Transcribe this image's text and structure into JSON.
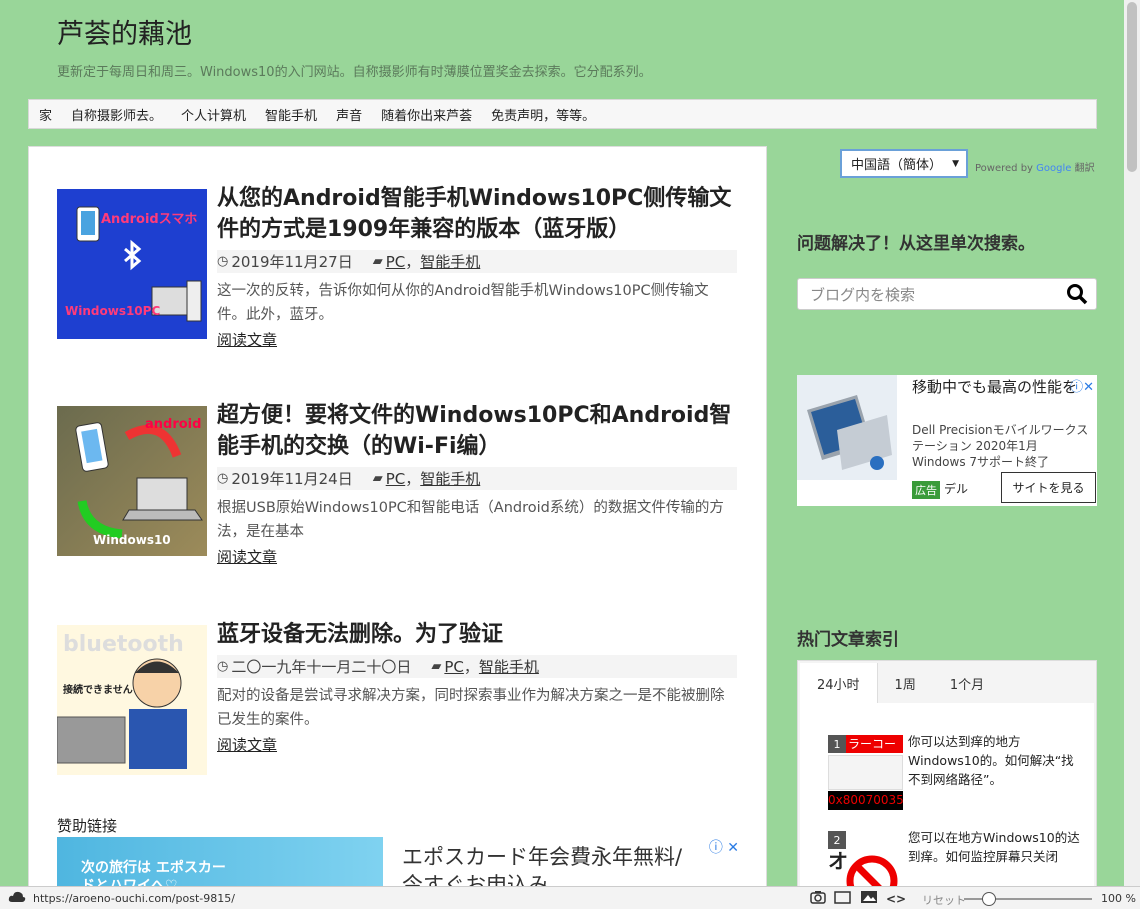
{
  "site": {
    "title": "芦荟的藕池",
    "description": "更新定于每周日和周三。Windows10的入门网站。自称摄影师有时薄膜位置奖金去探索。它分配系列。"
  },
  "nav": {
    "items": [
      "家",
      "自称摄影师去。",
      "个人计算机",
      "智能手机",
      "声音",
      "随着你出来芦荟",
      "免责声明，等等。"
    ]
  },
  "posts": [
    {
      "title": "从您的Android智能手机Windows10PC侧传输文件的方式是1909年兼容的版本（蓝牙版）",
      "date": "2019年11月27日",
      "cat1": "PC",
      "cat2": "智能手机",
      "excerpt": "这一次的反转，告诉你如何从你的Android智能手机Windows10PC侧传输文件。此外，蓝牙。",
      "more": "阅读文章",
      "thumb_text_top": "Androidスマホ",
      "thumb_text_bottom": "Windows10PC"
    },
    {
      "title": "超方便！要将文件的Windows10PC和Android智能手机的交换（的Wi-Fi编）",
      "date": "2019年11月24日",
      "cat1": "PC",
      "cat2": "智能手机",
      "excerpt": "根据USB原始Windows10PC和智能电话（Android系统）的数据文件传输的方法，是在基本",
      "more": "阅读文章",
      "thumb_text_top": "android",
      "thumb_text_bottom": "Windows10"
    },
    {
      "title": "蓝牙设备无法删除。为了验证",
      "date": "二〇一九年十一月二十〇日",
      "cat1": "PC",
      "cat2": "智能手机",
      "excerpt": "配对的设备是尝试寻求解决方案，同时探索事业作为解决方案之一是不能被删除已发生的案件。",
      "more": "阅读文章",
      "thumb_text_top": "bluetooth",
      "thumb_text_bottom": "接続できません"
    }
  ],
  "sponsor": {
    "label": "赞助链接",
    "ad_text_line1": "エポスカード年会費永年無料/",
    "ad_text_line2": "今すぐお申込み",
    "ad_img_text": "次の旅行は エポスカードとハワイへ♡"
  },
  "sidebar": {
    "lang": "中国語（簡体）",
    "powered_prefix": "Powered by",
    "powered_brand": "Google",
    "powered_suffix": "翻訳",
    "search_title": "问题解决了！从这里单次搜索。",
    "search_placeholder": "ブログ内を検索",
    "ad": {
      "title": "移動中でも最高の性能を",
      "sub": "Dell Precisionモバイルワークステーション 2020年1月 Windows 7サポート終了",
      "badge": "広告",
      "advertiser": "デル",
      "visit": "サイトを見る"
    },
    "popular_title": "热门文章索引",
    "tabs": [
      "24小时",
      "1周",
      "1个月"
    ],
    "popular": [
      {
        "rank": "1",
        "text": "你可以达到痒的地方Windows10的。如何解决“找不到网络路径”。",
        "thumb_top": "ラーコード",
        "thumb_bottom": "0x80070035"
      },
      {
        "rank": "2",
        "text": "您可以在地方Windows10的达到痒。如何监控屏幕只关闭",
        "thumb_top": "オ",
        "thumb_bottom": ""
      }
    ]
  },
  "statusbar": {
    "url": "https://aroeno-ouchi.com/post-9815/",
    "reset": "リセット",
    "zoom": "100 %"
  },
  "colors": {
    "page_bg": "#99d699",
    "accent_blue": "#2a7be4"
  }
}
